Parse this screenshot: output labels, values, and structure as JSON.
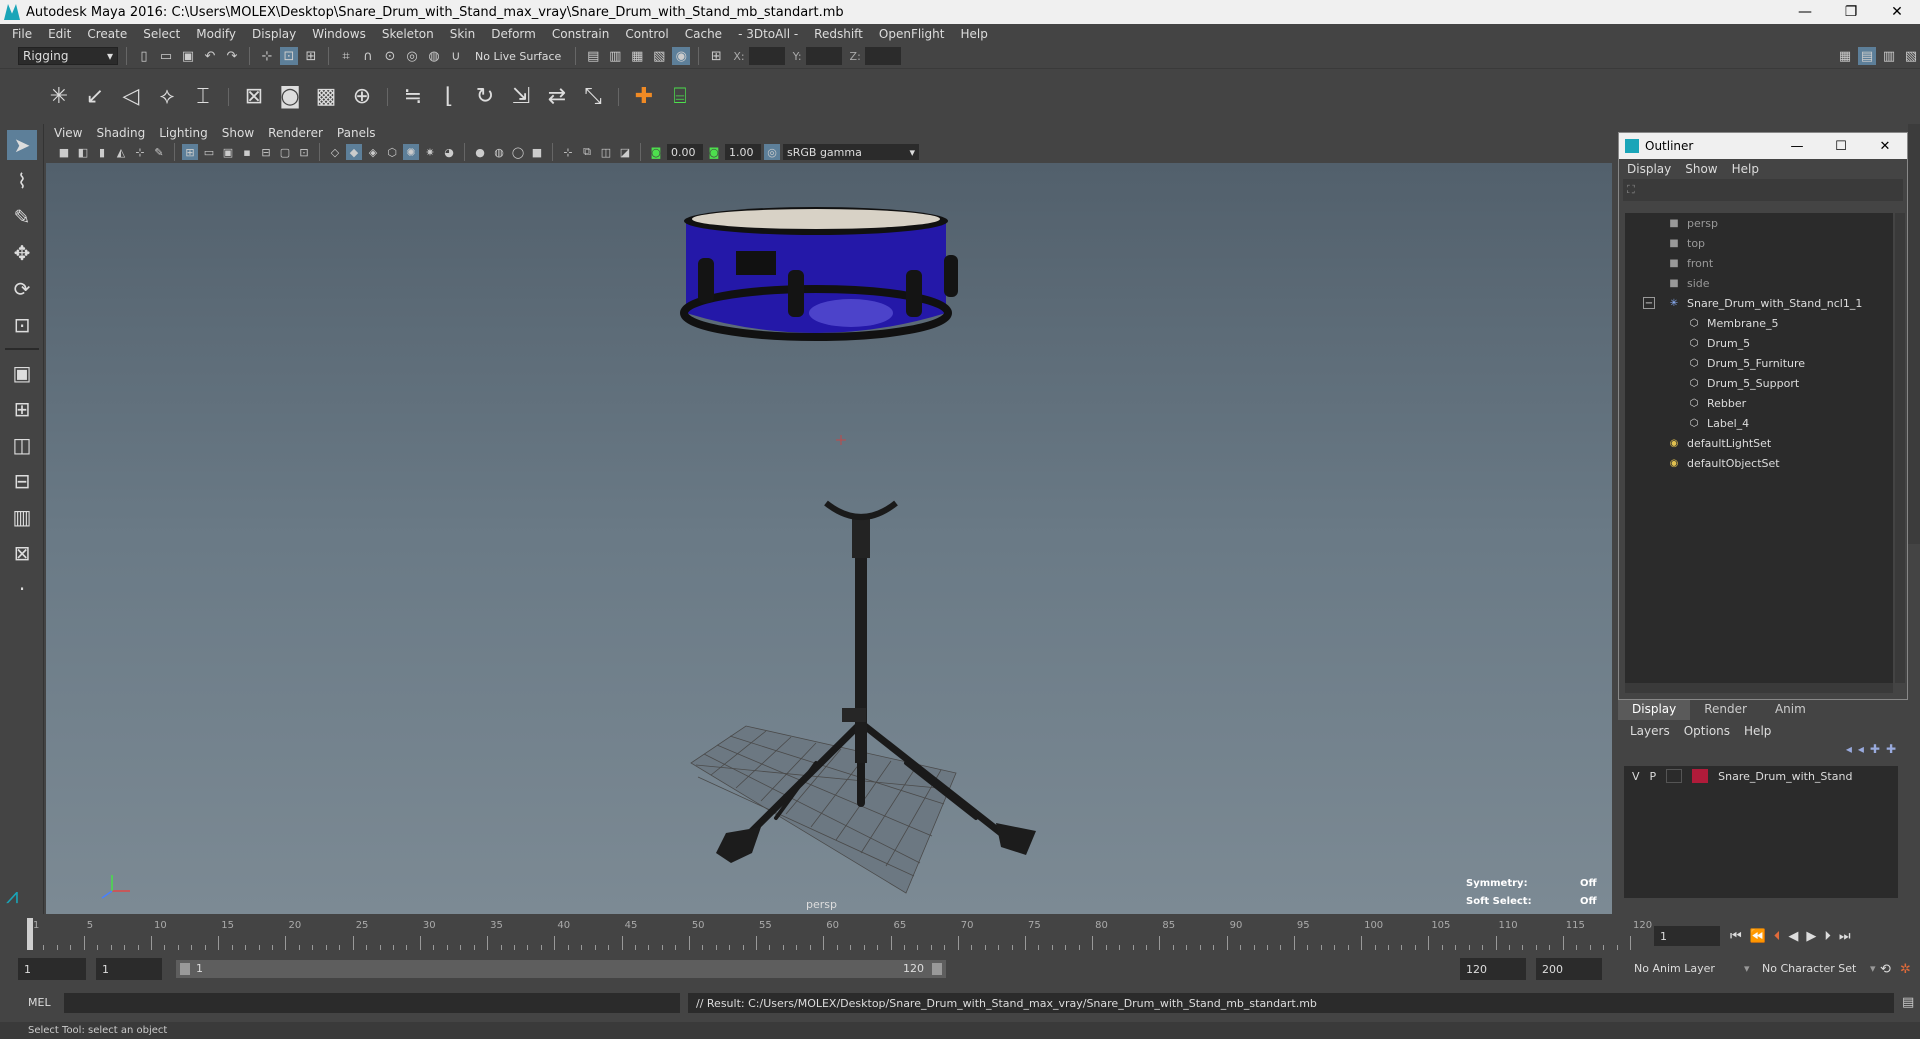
{
  "window": {
    "title": "Autodesk Maya 2016: C:\\Users\\MOLEX\\Desktop\\Snare_Drum_with_Stand_max_vray\\Snare_Drum_with_Stand_mb_standart.mb",
    "minimize": "—",
    "maximize": "❐",
    "close": "✕"
  },
  "menubar": [
    "File",
    "Edit",
    "Create",
    "Select",
    "Modify",
    "Display",
    "Windows",
    "Skeleton",
    "Skin",
    "Deform",
    "Constrain",
    "Control",
    "Cache",
    "- 3DtoAll -",
    "Redshift",
    "OpenFlight",
    "Help"
  ],
  "statusline": {
    "menuset": "Rigging",
    "live_surface": "No Live Surface",
    "x_label": "X:",
    "y_label": "Y:",
    "z_label": "Z:"
  },
  "panel": {
    "menus": [
      "View",
      "Shading",
      "Lighting",
      "Show",
      "Renderer",
      "Panels"
    ],
    "exposure": "0.00",
    "gamma": "1.00",
    "color_space": "sRGB gamma"
  },
  "viewport": {
    "camera": "persp",
    "symmetry_label": "Symmetry:",
    "symmetry_value": "Off",
    "soft_select_label": "Soft Select:",
    "soft_select_value": "Off"
  },
  "outliner": {
    "title": "Outliner",
    "menus": [
      "Display",
      "Show",
      "Help"
    ],
    "items": [
      {
        "label": "persp",
        "kind": "camera",
        "indent": 0
      },
      {
        "label": "top",
        "kind": "camera",
        "indent": 0
      },
      {
        "label": "front",
        "kind": "camera",
        "indent": 0
      },
      {
        "label": "side",
        "kind": "camera",
        "indent": 0
      },
      {
        "label": "Snare_Drum_with_Stand_ncl1_1",
        "kind": "group",
        "indent": 0
      },
      {
        "label": "Membrane_5",
        "kind": "mesh",
        "indent": 1
      },
      {
        "label": "Drum_5",
        "kind": "mesh",
        "indent": 1
      },
      {
        "label": "Drum_5_Furniture",
        "kind": "mesh",
        "indent": 1
      },
      {
        "label": "Drum_5_Support",
        "kind": "mesh",
        "indent": 1
      },
      {
        "label": "Rebber",
        "kind": "mesh",
        "indent": 1
      },
      {
        "label": "Label_4",
        "kind": "mesh",
        "indent": 1
      },
      {
        "label": "defaultLightSet",
        "kind": "set",
        "indent": 0
      },
      {
        "label": "defaultObjectSet",
        "kind": "set",
        "indent": 0
      }
    ]
  },
  "layer_editor": {
    "tabs": [
      "Display",
      "Render",
      "Anim"
    ],
    "menus": [
      "Layers",
      "Options",
      "Help"
    ],
    "layers": [
      {
        "v": "V",
        "p": "P",
        "name": "Snare_Drum_with_Stand",
        "color": "#b01b3a"
      }
    ]
  },
  "timeslider": {
    "ticks": [
      "1",
      "5",
      "10",
      "15",
      "20",
      "25",
      "30",
      "35",
      "40",
      "45",
      "50",
      "55",
      "60",
      "65",
      "70",
      "75",
      "80",
      "85",
      "90",
      "95",
      "100",
      "105",
      "110",
      "115",
      "120"
    ],
    "current_frame": "1"
  },
  "range": {
    "start": "1",
    "playback_start": "1",
    "slider_start": "1",
    "slider_end": "120",
    "playback_end": "120",
    "end": "200",
    "anim_layer": "No Anim Layer",
    "character_set": "No Character Set"
  },
  "cmdline": {
    "mel_label": "MEL",
    "result": "// Result: C:/Users/MOLEX/Desktop/Snare_Drum_with_Stand_max_vray/Snare_Drum_with_Stand_mb_standart.mb"
  },
  "helpline": "Select Tool: select an object",
  "colors": {
    "accent": "#5d7f99",
    "drum_shell": "#2a1fb8",
    "layer_color": "#b01b3a"
  }
}
